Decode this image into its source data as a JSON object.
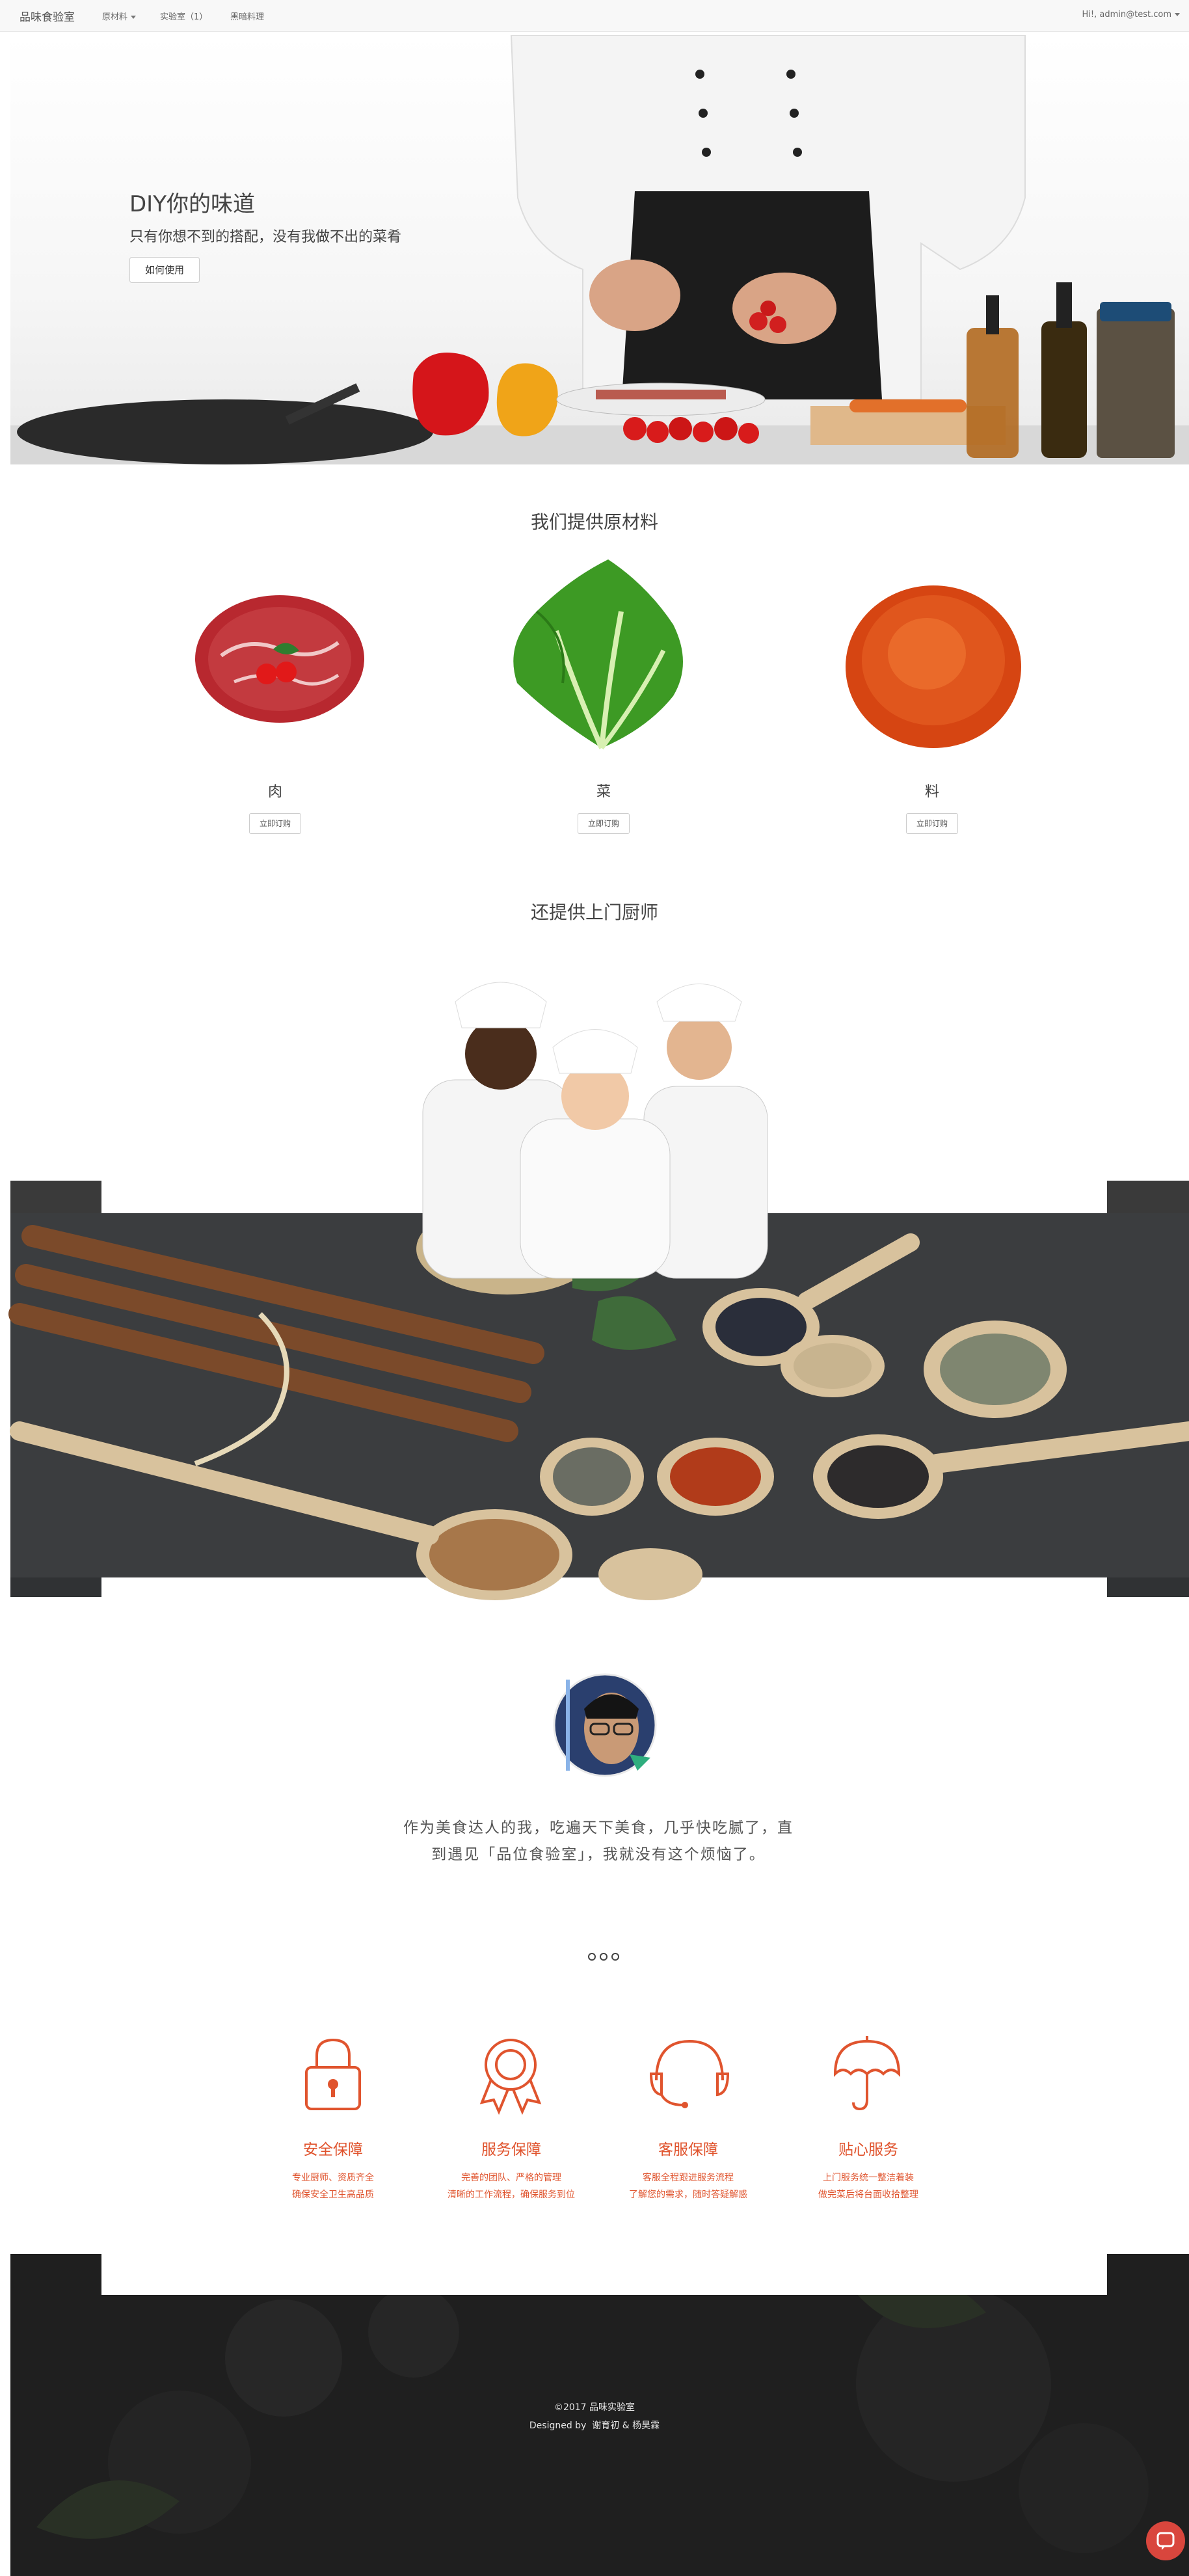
{
  "navbar": {
    "brand": "品味食验室",
    "items": [
      {
        "label": "原材料"
      },
      {
        "label": "实验室（1）"
      },
      {
        "label": "黑暗料理"
      }
    ],
    "user": "Hi!, admin@test.com"
  },
  "hero": {
    "title": "DIY你的味道",
    "subtitle": "只有你想不到的搭配，没有我做不出的菜肴",
    "button": "如何使用"
  },
  "materials": {
    "title": "我们提供原材料",
    "items": [
      {
        "name": "肉",
        "button": "立即订购"
      },
      {
        "name": "菜",
        "button": "立即订购"
      },
      {
        "name": "料",
        "button": "立即订购"
      }
    ]
  },
  "chefs": {
    "title": "还提供上门厨师"
  },
  "testimonial": {
    "text": "作为美食达人的我，吃遍天下美食，几乎快吃腻了，直到遇见「品位食验室」，我就没有这个烦恼了。"
  },
  "features": [
    {
      "icon": "lock-icon",
      "title": "安全保障",
      "lines": [
        "专业厨师、资质齐全",
        "确保安全卫生高品质"
      ]
    },
    {
      "icon": "award-icon",
      "title": "服务保障",
      "lines": [
        "完善的团队、严格的管理",
        "清晰的工作流程，确保服务到位"
      ]
    },
    {
      "icon": "headset-icon",
      "title": "客服保障",
      "lines": [
        "客服全程跟进服务流程",
        "了解您的需求，随时答疑解惑"
      ]
    },
    {
      "icon": "umbrella-icon",
      "title": "贴心服务",
      "lines": [
        "上门服务统一整洁着装",
        "做完菜后将台面收拾整理"
      ]
    }
  ],
  "footer": {
    "copyright": "©2017 品味实验室",
    "designed_prefix": "Designed by",
    "designers": "谢育初 & 杨昊霖"
  },
  "colors": {
    "accent": "#e0542e",
    "footer_bg": "#1f1f1f"
  }
}
